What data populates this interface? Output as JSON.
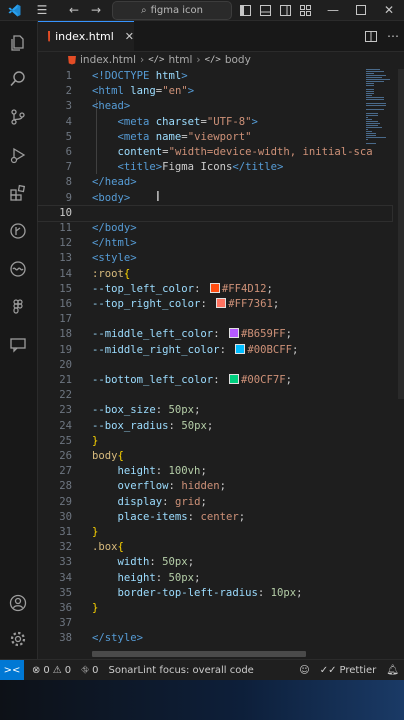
{
  "titlebar": {
    "search_text": "figma icon"
  },
  "tab": {
    "label": "index.html"
  },
  "breadcrumb": {
    "file": "index.html",
    "items": [
      "html",
      "body"
    ]
  },
  "editor": {
    "lines": [
      {
        "n": "1",
        "tokens": [
          {
            "t": "<!DOCTYPE ",
            "c": "k-tag"
          },
          {
            "t": "html",
            "c": "k-attr"
          },
          {
            "t": ">",
            "c": "k-tag"
          }
        ]
      },
      {
        "n": "2",
        "tokens": [
          {
            "t": "<html ",
            "c": "k-tag"
          },
          {
            "t": "lang",
            "c": "k-attr"
          },
          {
            "t": "=",
            "c": ""
          },
          {
            "t": "\"en\"",
            "c": "k-str"
          },
          {
            "t": ">",
            "c": "k-tag"
          }
        ]
      },
      {
        "n": "3",
        "tokens": [
          {
            "t": "<head>",
            "c": "k-tag"
          }
        ]
      },
      {
        "n": "4",
        "tokens": [
          {
            "t": "    <meta ",
            "c": "k-tag"
          },
          {
            "t": "charset",
            "c": "k-attr"
          },
          {
            "t": "=",
            "c": ""
          },
          {
            "t": "\"UTF-8\"",
            "c": "k-str"
          },
          {
            "t": ">",
            "c": "k-tag"
          }
        ]
      },
      {
        "n": "5",
        "tokens": [
          {
            "t": "    <meta ",
            "c": "k-tag"
          },
          {
            "t": "name",
            "c": "k-attr"
          },
          {
            "t": "=",
            "c": ""
          },
          {
            "t": "\"viewport\"",
            "c": "k-str"
          }
        ]
      },
      {
        "n": "6",
        "tokens": [
          {
            "t": "    content",
            "c": "k-attr"
          },
          {
            "t": "=",
            "c": ""
          },
          {
            "t": "\"width=device-width, initial-sca",
            "c": "k-str"
          }
        ]
      },
      {
        "n": "7",
        "tokens": [
          {
            "t": "    <title>",
            "c": "k-tag"
          },
          {
            "t": "Figma Icons",
            "c": ""
          },
          {
            "t": "</title>",
            "c": "k-tag"
          }
        ]
      },
      {
        "n": "8",
        "tokens": [
          {
            "t": "</head>",
            "c": "k-tag"
          }
        ]
      },
      {
        "n": "9",
        "tokens": [
          {
            "t": "<body>",
            "c": "k-tag"
          }
        ]
      },
      {
        "n": "10",
        "tokens": [],
        "current": true
      },
      {
        "n": "11",
        "tokens": [
          {
            "t": "</body>",
            "c": "k-tag"
          }
        ]
      },
      {
        "n": "12",
        "tokens": [
          {
            "t": "</html>",
            "c": "k-tag"
          }
        ]
      },
      {
        "n": "13",
        "tokens": [
          {
            "t": "<style>",
            "c": "k-tag"
          }
        ]
      },
      {
        "n": "14",
        "tokens": [
          {
            "t": ":root",
            "c": "k-sel"
          },
          {
            "t": "{",
            "c": "k-brace"
          }
        ]
      },
      {
        "n": "15",
        "tokens": [
          {
            "t": "--top_left_color",
            "c": "k-prop"
          },
          {
            "t": ": ",
            "c": ""
          },
          {
            "t": "",
            "swatch": "#FF4D12"
          },
          {
            "t": "#FF4D12",
            "c": "k-val"
          },
          {
            "t": ";",
            "c": ""
          }
        ]
      },
      {
        "n": "16",
        "tokens": [
          {
            "t": "--top_right_color",
            "c": "k-prop"
          },
          {
            "t": ": ",
            "c": ""
          },
          {
            "t": "",
            "swatch": "#FF7361"
          },
          {
            "t": "#FF7361",
            "c": "k-val"
          },
          {
            "t": ";",
            "c": ""
          }
        ]
      },
      {
        "n": "17",
        "tokens": []
      },
      {
        "n": "18",
        "tokens": [
          {
            "t": "--middle_left_color",
            "c": "k-prop"
          },
          {
            "t": ": ",
            "c": ""
          },
          {
            "t": "",
            "swatch": "#B659FF"
          },
          {
            "t": "#B659FF",
            "c": "k-val"
          },
          {
            "t": ";",
            "c": ""
          }
        ]
      },
      {
        "n": "19",
        "tokens": [
          {
            "t": "--middle_right_color",
            "c": "k-prop"
          },
          {
            "t": ": ",
            "c": ""
          },
          {
            "t": "",
            "swatch": "#00BCFF"
          },
          {
            "t": "#00BCFF",
            "c": "k-val"
          },
          {
            "t": ";",
            "c": ""
          }
        ]
      },
      {
        "n": "20",
        "tokens": []
      },
      {
        "n": "21",
        "tokens": [
          {
            "t": "--bottom_left_color",
            "c": "k-prop"
          },
          {
            "t": ": ",
            "c": ""
          },
          {
            "t": "",
            "swatch": "#00CF7F"
          },
          {
            "t": "#00CF7F",
            "c": "k-val"
          },
          {
            "t": ";",
            "c": ""
          }
        ]
      },
      {
        "n": "22",
        "tokens": []
      },
      {
        "n": "23",
        "tokens": [
          {
            "t": "--box_size",
            "c": "k-prop"
          },
          {
            "t": ": ",
            "c": ""
          },
          {
            "t": "50px",
            "c": "k-num"
          },
          {
            "t": ";",
            "c": ""
          }
        ]
      },
      {
        "n": "24",
        "tokens": [
          {
            "t": "--box_radius",
            "c": "k-prop"
          },
          {
            "t": ": ",
            "c": ""
          },
          {
            "t": "50px",
            "c": "k-num"
          },
          {
            "t": ";",
            "c": ""
          }
        ]
      },
      {
        "n": "25",
        "tokens": [
          {
            "t": "}",
            "c": "k-brace"
          }
        ]
      },
      {
        "n": "26",
        "tokens": [
          {
            "t": "body",
            "c": "k-sel"
          },
          {
            "t": "{",
            "c": "k-brace"
          }
        ]
      },
      {
        "n": "27",
        "tokens": [
          {
            "t": "    height",
            "c": "k-prop"
          },
          {
            "t": ": ",
            "c": ""
          },
          {
            "t": "100vh",
            "c": "k-num"
          },
          {
            "t": ";",
            "c": ""
          }
        ]
      },
      {
        "n": "28",
        "tokens": [
          {
            "t": "    overflow",
            "c": "k-prop"
          },
          {
            "t": ": ",
            "c": ""
          },
          {
            "t": "hidden",
            "c": "k-val"
          },
          {
            "t": ";",
            "c": ""
          }
        ]
      },
      {
        "n": "29",
        "tokens": [
          {
            "t": "    display",
            "c": "k-prop"
          },
          {
            "t": ": ",
            "c": ""
          },
          {
            "t": "grid",
            "c": "k-val"
          },
          {
            "t": ";",
            "c": ""
          }
        ]
      },
      {
        "n": "30",
        "tokens": [
          {
            "t": "    place-items",
            "c": "k-prop"
          },
          {
            "t": ": ",
            "c": ""
          },
          {
            "t": "center",
            "c": "k-val"
          },
          {
            "t": ";",
            "c": ""
          }
        ]
      },
      {
        "n": "31",
        "tokens": [
          {
            "t": "}",
            "c": "k-brace"
          }
        ]
      },
      {
        "n": "32",
        "tokens": [
          {
            "t": ".box",
            "c": "k-sel"
          },
          {
            "t": "{",
            "c": "k-brace"
          }
        ]
      },
      {
        "n": "33",
        "tokens": [
          {
            "t": "    width",
            "c": "k-prop"
          },
          {
            "t": ": ",
            "c": ""
          },
          {
            "t": "50px",
            "c": "k-num"
          },
          {
            "t": ";",
            "c": ""
          }
        ]
      },
      {
        "n": "34",
        "tokens": [
          {
            "t": "    height",
            "c": "k-prop"
          },
          {
            "t": ": ",
            "c": ""
          },
          {
            "t": "50px",
            "c": "k-num"
          },
          {
            "t": ";",
            "c": ""
          }
        ]
      },
      {
        "n": "35",
        "tokens": [
          {
            "t": "    border-top-left-radius",
            "c": "k-prop"
          },
          {
            "t": ": ",
            "c": ""
          },
          {
            "t": "10px",
            "c": "k-num"
          },
          {
            "t": ";",
            "c": ""
          }
        ]
      },
      {
        "n": "36",
        "tokens": [
          {
            "t": "}",
            "c": "k-brace"
          }
        ]
      },
      {
        "n": "37",
        "tokens": []
      },
      {
        "n": "38",
        "tokens": [
          {
            "t": "</style>",
            "c": "k-tag"
          }
        ]
      }
    ]
  },
  "statusbar": {
    "errors": "0",
    "warnings": "0",
    "ports": "0",
    "sonarlint": "SonarLint focus: overall code",
    "prettier": "Prettier"
  },
  "colors": {
    "accent": "#0078d4",
    "tab_border": "#3794ff"
  }
}
